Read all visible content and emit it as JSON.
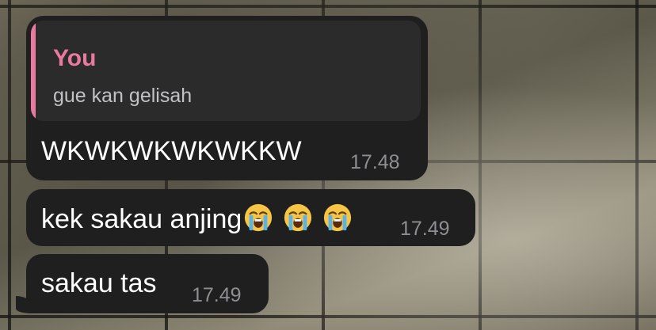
{
  "messages": [
    {
      "reply": {
        "author": "You",
        "text": "gue kan gelisah"
      },
      "text": "WKWKWKWKWKKW",
      "time": "17.48"
    },
    {
      "text": "kek sakau anjing",
      "emojis": [
        "loudly-crying-face-icon",
        "loudly-crying-face-icon",
        "loudly-crying-face-icon"
      ],
      "time": "17.49"
    },
    {
      "text": "sakau tas",
      "time": "17.49"
    }
  ],
  "colors": {
    "bubble": "#1f1f1f",
    "reply_accent": "#e87aa0",
    "timestamp": "#8e8e93"
  }
}
